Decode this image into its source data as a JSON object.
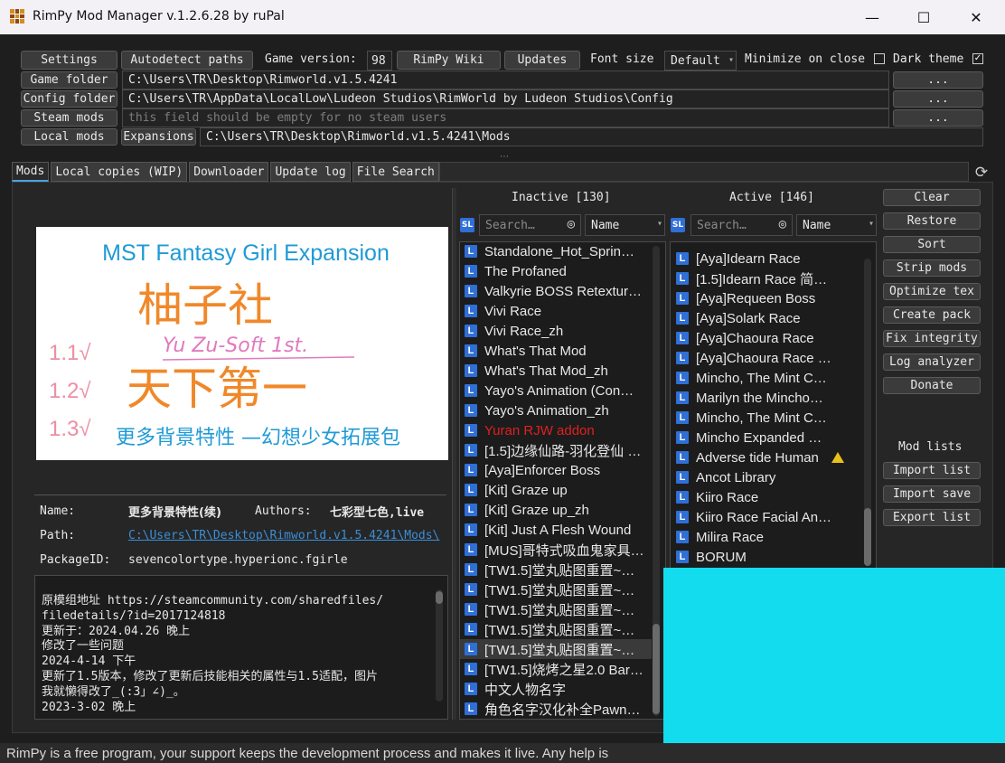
{
  "window": {
    "title": "RimPy Mod Manager v.1.2.6.28 by ruPal",
    "minimize_glyph": "—",
    "maximize_glyph": "☐",
    "close_glyph": "✕"
  },
  "toolbar": {
    "settings": "Settings",
    "autodetect": "Autodetect paths",
    "game_version_label": "Game version:",
    "game_version_value": "98",
    "wiki": "RimPy Wiki",
    "updates": "Updates",
    "font_size_label": "Font size",
    "font_size_value": "Default",
    "minimize_on_close": "Minimize on close",
    "minimize_checked": "",
    "dark_theme": "Dark theme",
    "dark_theme_checked": "✓"
  },
  "paths": {
    "game_folder_label": "Game folder",
    "game_folder_value": "C:\\Users\\TR\\Desktop\\Rimworld.v1.5.4241",
    "config_folder_label": "Config folder",
    "config_folder_value": "C:\\Users\\TR\\AppData\\LocalLow\\Ludeon Studios\\RimWorld by Ludeon Studios\\Config",
    "steam_mods_label": "Steam mods",
    "steam_mods_placeholder": "this field should be empty for no steam users",
    "local_mods_label": "Local mods",
    "expansions_label": "Expansions",
    "local_mods_value": "C:\\Users\\TR\\Desktop\\Rimworld.v1.5.4241\\Mods",
    "browse": "..."
  },
  "tabs": [
    "Mods",
    "Local copies (WIP)",
    "Downloader",
    "Update log",
    "File Search"
  ],
  "preview": {
    "title": "MST Fantasy Girl Expansion",
    "hand_line1": "柚子社",
    "hand_line2": "Yu Zu-Soft 1st.",
    "hand_line3": "天下第一",
    "versions": [
      "1.1√",
      "1.2√",
      "1.3√"
    ],
    "subtitle": "更多背景特性 —幻想少女拓展包"
  },
  "info": {
    "name_label": "Name:",
    "name_value": "更多背景特性(续)",
    "authors_label": "Authors:",
    "authors_value": "七彩型七色,live",
    "path_label": "Path:",
    "path_value": "C:\\Users\\TR\\Desktop\\Rimworld.v1.5.4241\\Mods\\",
    "package_label": "PackageID:",
    "package_value": "sevencolortype.hyperionc.fgirle"
  },
  "description": [
    "原模组地址 https://steamcommunity.com/sharedfiles/",
    "filedetails/?id=2017124818",
    "更新于：2024.04.26 晚上",
    "修改了一些问题",
    "2024-4-14 下午",
    "更新了1.5版本，修改了更新后技能相关的属性与1.5适配，图片",
    "我就懒得改了_(:3」∠)_。",
    "2023-3-02 晚上"
  ],
  "inactive": {
    "header": "Inactive [130]",
    "search_placeholder": "Search…",
    "sort": "Name",
    "items": [
      {
        "name": "Standalone_Hot_Sprin…",
        "style": ""
      },
      {
        "name": "The Profaned",
        "style": ""
      },
      {
        "name": "Valkyrie BOSS Retextur…",
        "style": ""
      },
      {
        "name": "Vivi Race",
        "style": ""
      },
      {
        "name": "Vivi Race_zh",
        "style": ""
      },
      {
        "name": "What's That Mod",
        "style": ""
      },
      {
        "name": "What's That Mod_zh",
        "style": ""
      },
      {
        "name": "Yayo's Animation (Con…",
        "style": ""
      },
      {
        "name": "Yayo's Animation_zh",
        "style": ""
      },
      {
        "name": "Yuran RJW addon",
        "style": "red"
      },
      {
        "name": "[1.5]边缘仙路-羽化登仙 …",
        "style": ""
      },
      {
        "name": "[Aya]Enforcer Boss",
        "style": ""
      },
      {
        "name": "[Kit] Graze up",
        "style": ""
      },
      {
        "name": "[Kit] Graze up_zh",
        "style": ""
      },
      {
        "name": "[Kit] Just A Flesh Wound",
        "style": ""
      },
      {
        "name": "[MUS]哥特式吸血鬼家具…",
        "style": ""
      },
      {
        "name": "[TW1.5]堂丸贴图重置~…",
        "style": ""
      },
      {
        "name": "[TW1.5]堂丸贴图重置~…",
        "style": ""
      },
      {
        "name": "[TW1.5]堂丸贴图重置~…",
        "style": ""
      },
      {
        "name": "[TW1.5]堂丸贴图重置~…",
        "style": ""
      },
      {
        "name": "[TW1.5]堂丸贴图重置~…",
        "style": "sel"
      },
      {
        "name": "[TW1.5]烧烤之星2.0 Bar…",
        "style": ""
      },
      {
        "name": "中文人物名字",
        "style": ""
      },
      {
        "name": "角色名字汉化补全Pawn…",
        "style": ""
      }
    ]
  },
  "active": {
    "header": "Active [146]",
    "search_placeholder": "Search…",
    "sort": "Name",
    "items": [
      {
        "name": "[Aya]Idearn Race",
        "warn": false
      },
      {
        "name": "[1.5]Idearn Race 简…",
        "warn": false
      },
      {
        "name": "[Aya]Requeen Boss",
        "warn": false
      },
      {
        "name": "[Aya]Solark Race",
        "warn": false
      },
      {
        "name": "[Aya]Chaoura Race",
        "warn": false
      },
      {
        "name": "[Aya]Chaoura Race …",
        "warn": false
      },
      {
        "name": "Mincho, The Mint C…",
        "warn": false
      },
      {
        "name": "Marilyn the Mincho…",
        "warn": false
      },
      {
        "name": "Mincho, The Mint C…",
        "warn": false
      },
      {
        "name": "Mincho Expanded …",
        "warn": false
      },
      {
        "name": "Adverse tide Human",
        "warn": true
      },
      {
        "name": "Ancot Library",
        "warn": false
      },
      {
        "name": "Kiiro Race",
        "warn": false
      },
      {
        "name": "Kiiro Race Facial An…",
        "warn": false
      },
      {
        "name": "Milira Race",
        "warn": false
      },
      {
        "name": "BORUM",
        "warn": false
      }
    ]
  },
  "actions": [
    "Clear",
    "Restore",
    "Sort",
    "Strip mods",
    "Optimize tex",
    "Create pack",
    "Fix integrity",
    "Log analyzer",
    "Donate"
  ],
  "modlists": {
    "header": "Mod lists",
    "buttons": [
      "Import list",
      "Import save",
      "Export list"
    ]
  },
  "status": "RimPy is a free program, your support keeps the development process and makes it live. Any help is",
  "badge_letter": "L",
  "sl_letter": "SL",
  "colors": {
    "accent_cyan": "#13dcef",
    "badge_blue": "#2f6fd6",
    "warning_yellow": "#e8c21a",
    "error_red": "#e02020"
  }
}
